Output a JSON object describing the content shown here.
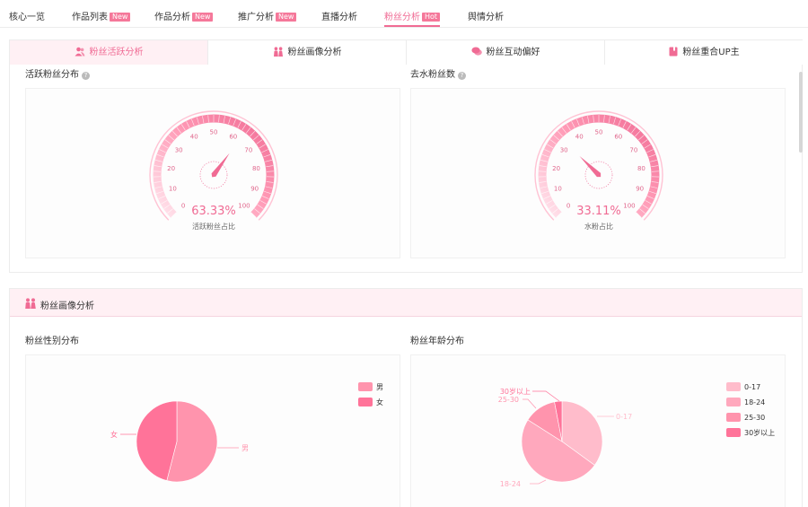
{
  "nav": [
    {
      "label": "核心一览",
      "badge": ""
    },
    {
      "label": "作品列表",
      "badge": "New"
    },
    {
      "label": "作品分析",
      "badge": "New"
    },
    {
      "label": "推广分析",
      "badge": "New"
    },
    {
      "label": "直播分析",
      "badge": ""
    },
    {
      "label": "粉丝分析",
      "badge": "Hot"
    },
    {
      "label": "舆情分析",
      "badge": ""
    }
  ],
  "nav_active_index": 5,
  "tabs": [
    {
      "label": "粉丝活跃分析",
      "icon": "users-icon"
    },
    {
      "label": "粉丝画像分析",
      "icon": "couple-icon"
    },
    {
      "label": "粉丝互动偏好",
      "icon": "chat-icon"
    },
    {
      "label": "粉丝重合UP主",
      "icon": "book-icon"
    }
  ],
  "tab_active_index": 0,
  "active_section": {
    "left_title": "活跃粉丝分布",
    "right_title": "去水粉丝数"
  },
  "portrait_section": {
    "header": "粉丝画像分析",
    "gender_title": "粉丝性别分布",
    "age_title": "粉丝年龄分布"
  },
  "colors": {
    "accent": "#f06b94",
    "male": "#ff94ad",
    "female": "#ff7399",
    "age_0_17": "#ffbccb",
    "age_18_24": "#ffa8bd",
    "age_25_30": "#ff94ad",
    "age_30_plus": "#ff7399"
  },
  "chart_data": [
    {
      "type": "gauge",
      "min": 0,
      "max": 100,
      "ticks": [
        "0",
        "10",
        "20",
        "30",
        "40",
        "50",
        "60",
        "70",
        "80",
        "90",
        "100"
      ],
      "value": 63.33,
      "value_text": "63.33%",
      "label": "活跃粉丝占比"
    },
    {
      "type": "gauge",
      "min": 0,
      "max": 100,
      "ticks": [
        "0",
        "10",
        "20",
        "30",
        "40",
        "50",
        "60",
        "70",
        "80",
        "90",
        "100"
      ],
      "value": 33.11,
      "value_text": "33.11%",
      "label": "水粉占比"
    },
    {
      "type": "pie",
      "title": "粉丝性别分布",
      "categories": [
        "男",
        "女"
      ],
      "values": [
        54,
        46
      ],
      "legend": "right"
    },
    {
      "type": "pie",
      "title": "粉丝年龄分布",
      "categories": [
        "0-17",
        "18-24",
        "25-30",
        "30岁以上"
      ],
      "values": [
        35,
        49,
        13,
        3
      ],
      "legend": "right"
    }
  ]
}
